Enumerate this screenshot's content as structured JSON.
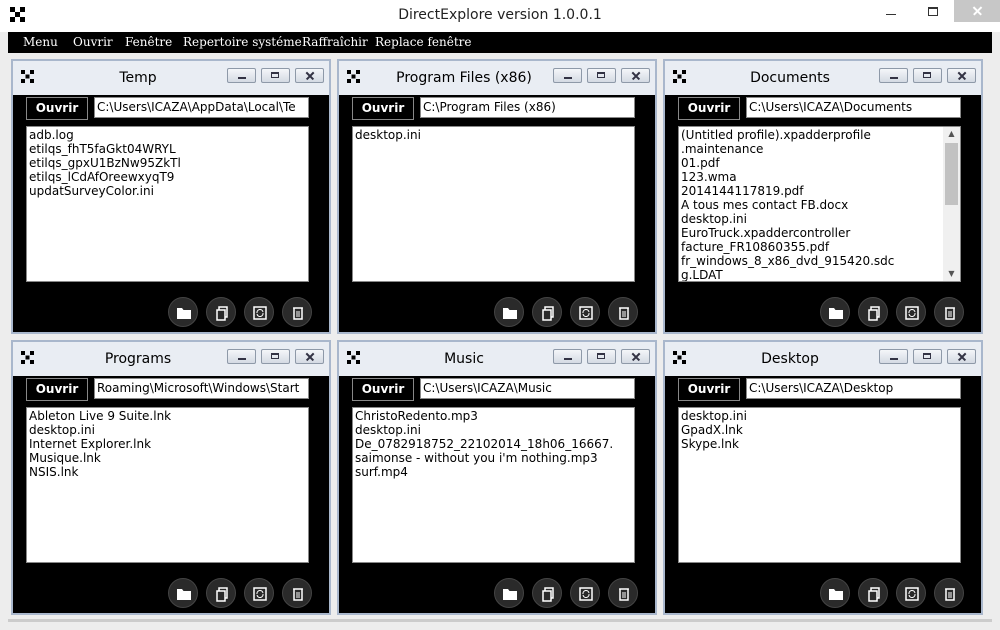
{
  "window": {
    "title": "DirectExplore version 1.0.0.1",
    "controls": {
      "minimize": "minimize-icon",
      "maximize": "maximize-icon",
      "close": "close-icon"
    }
  },
  "menu": {
    "items": [
      {
        "label": "Menu"
      },
      {
        "label": "Ouvrir"
      },
      {
        "label": "Fenêtre"
      },
      {
        "label": "Repertoire systéme"
      },
      {
        "label": "Raffraîchir"
      },
      {
        "label": "Replace fenêtre"
      }
    ]
  },
  "panels": [
    {
      "title": "Temp",
      "open_label": "Ouvrir",
      "path": "C:\\Users\\ICAZA\\AppData\\Local\\Te",
      "files": [
        "adb.log",
        "etilqs_fhT5faGkt04WRYL",
        "etilqs_gpxU1BzNw95ZkTl",
        "etilqs_lCdAfOreewxyqT9",
        "updatSurveyColor.ini"
      ]
    },
    {
      "title": "Program Files (x86)",
      "open_label": "Ouvrir",
      "path": "C:\\Program Files (x86)",
      "files": [
        "desktop.ini"
      ]
    },
    {
      "title": "Documents",
      "open_label": "Ouvrir",
      "path": "C:\\Users\\ICAZA\\Documents",
      "files": [
        "(Untitled profile).xpadderprofile",
        ".maintenance",
        "01.pdf",
        "123.wma",
        "2014144117819.pdf",
        "A tous mes contact FB.docx",
        "desktop.ini",
        "EuroTruck.xpaddercontroller",
        "facture_FR10860355.pdf",
        "fr_windows_8_x86_dvd_915420.sdc",
        "g.LDAT"
      ],
      "scrollbar": true
    },
    {
      "title": "Programs",
      "open_label": "Ouvrir",
      "path": "Roaming\\Microsoft\\Windows\\Start",
      "files": [
        "Ableton Live 9 Suite.lnk",
        "desktop.ini",
        "Internet Explorer.lnk",
        "Musique.lnk",
        "NSIS.lnk"
      ]
    },
    {
      "title": "Music",
      "open_label": "Ouvrir",
      "path": "C:\\Users\\ICAZA\\Music",
      "files": [
        "ChristoRedento.mp3",
        "desktop.ini",
        "De_0782918752_22102014_18h06_16667.",
        "saimonse - without you i'm nothing.mp3",
        "surf.mp4"
      ]
    },
    {
      "title": "Desktop",
      "open_label": "Ouvrir",
      "path": "C:\\Users\\ICAZA\\Desktop",
      "files": [
        "desktop.ini",
        "GpadX.lnk",
        "Skype.lnk"
      ]
    }
  ],
  "panel_actions": [
    "folder-icon",
    "copy-icon",
    "refresh-icon",
    "delete-icon"
  ],
  "colors": {
    "menubar": "#000000",
    "panel_bg": "#000000",
    "panel_titlebar": "#e9edf3",
    "panel_border": "#a9b7cc"
  }
}
